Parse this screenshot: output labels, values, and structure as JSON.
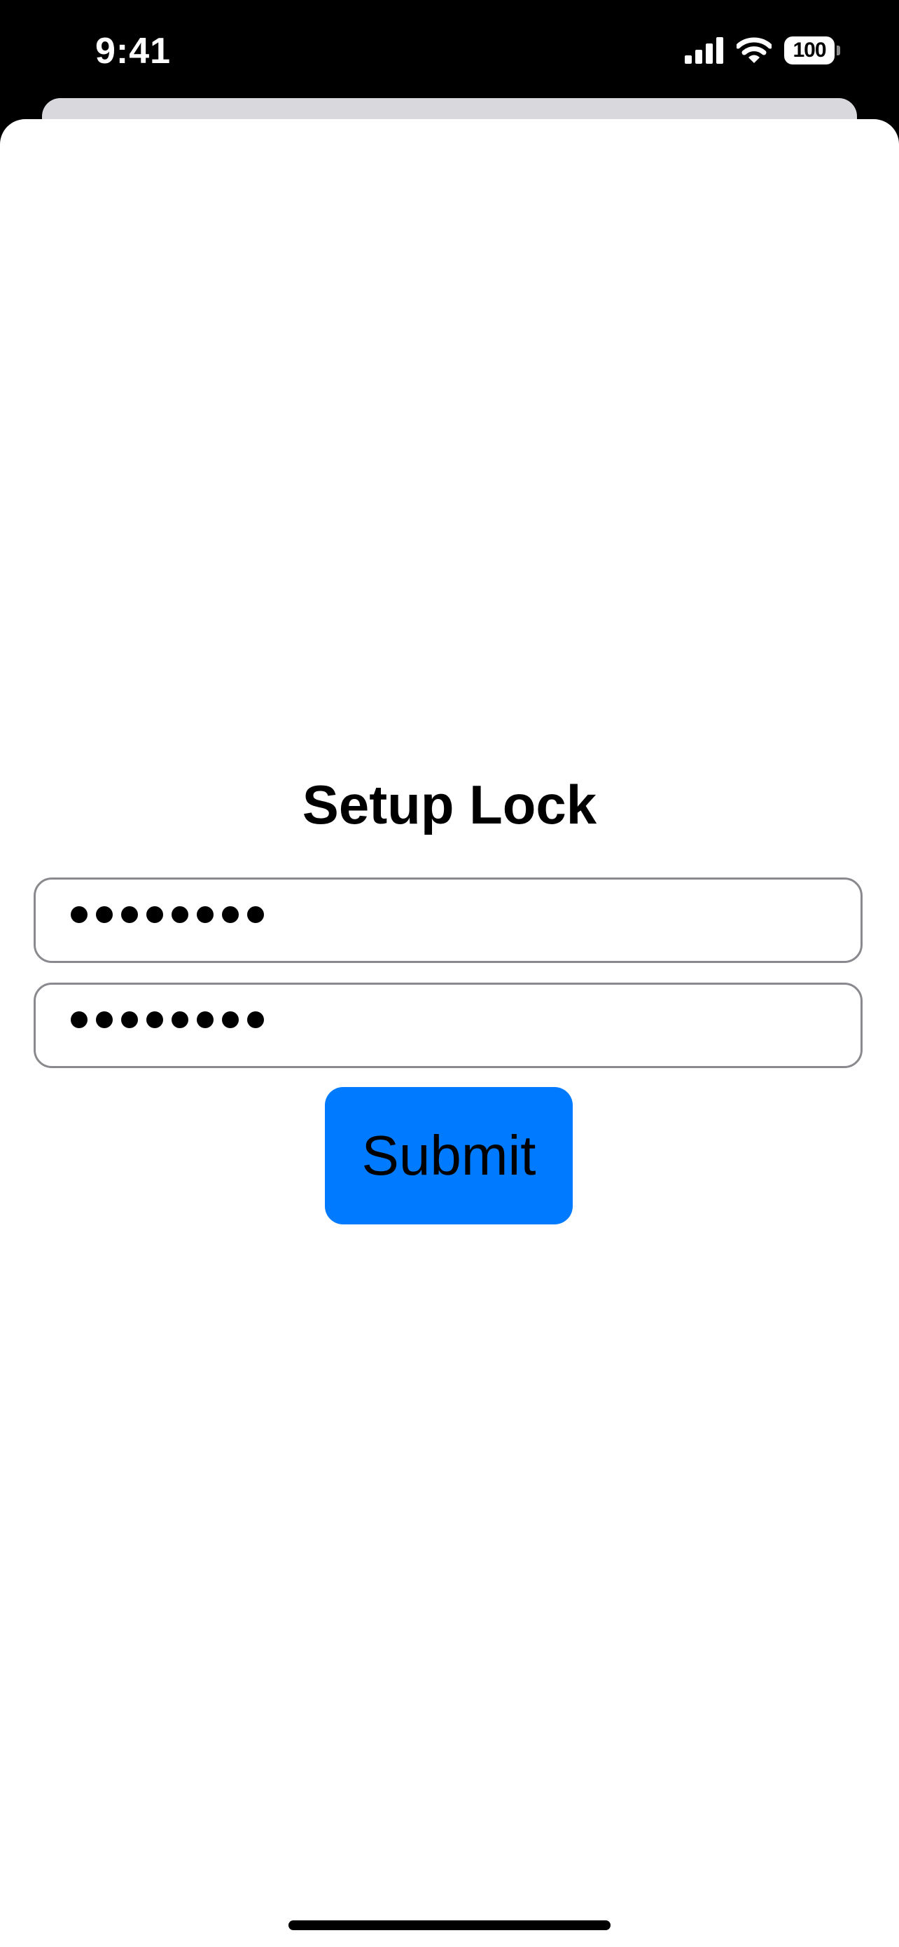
{
  "status_bar": {
    "time": "9:41",
    "battery_level": "100",
    "signal_icon": "cellular-signal-icon",
    "wifi_icon": "wifi-icon",
    "battery_icon": "battery-icon"
  },
  "form": {
    "title": "Setup Lock",
    "password_field": {
      "masked_length": 8,
      "mask_char": "●"
    },
    "confirm_password_field": {
      "masked_length": 8,
      "mask_char": "●"
    },
    "submit_label": "Submit"
  },
  "colors": {
    "accent": "#007aff",
    "field_border": "#8a8a8e",
    "background": "#ffffff",
    "status_bar_bg": "#000000"
  }
}
